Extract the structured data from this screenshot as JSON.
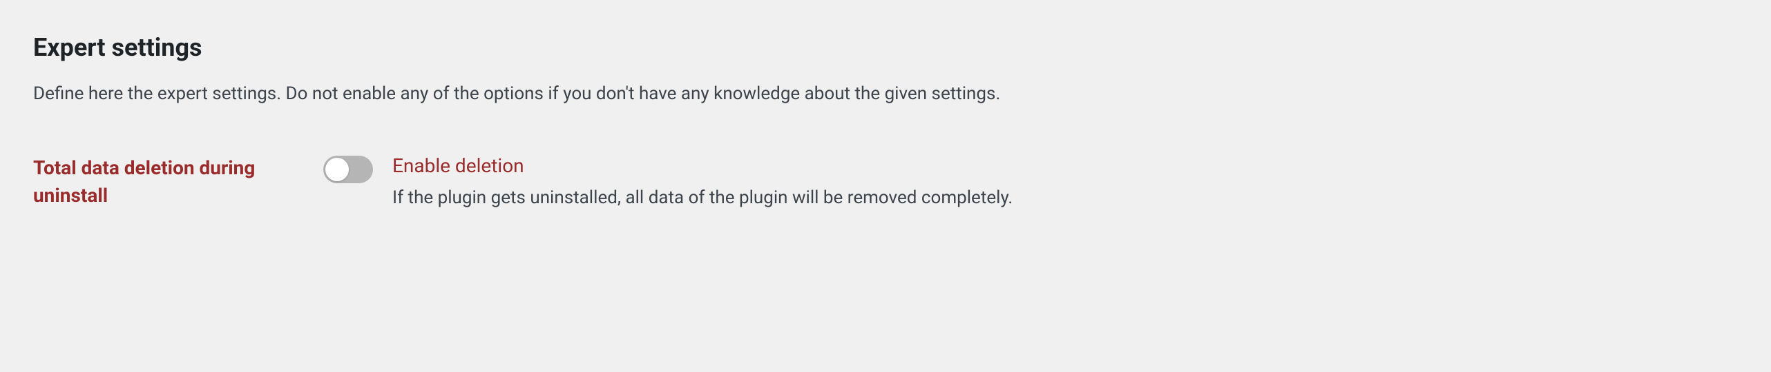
{
  "section": {
    "title": "Expert settings",
    "description": "Define here the expert settings. Do not enable any of the options if you don't have any knowledge about the given settings."
  },
  "settings": {
    "data_deletion": {
      "label": "Total data deletion during uninstall",
      "option_label": "Enable deletion",
      "option_description": "If the plugin gets uninstalled, all data of the plugin will be removed completely.",
      "enabled": false
    }
  }
}
